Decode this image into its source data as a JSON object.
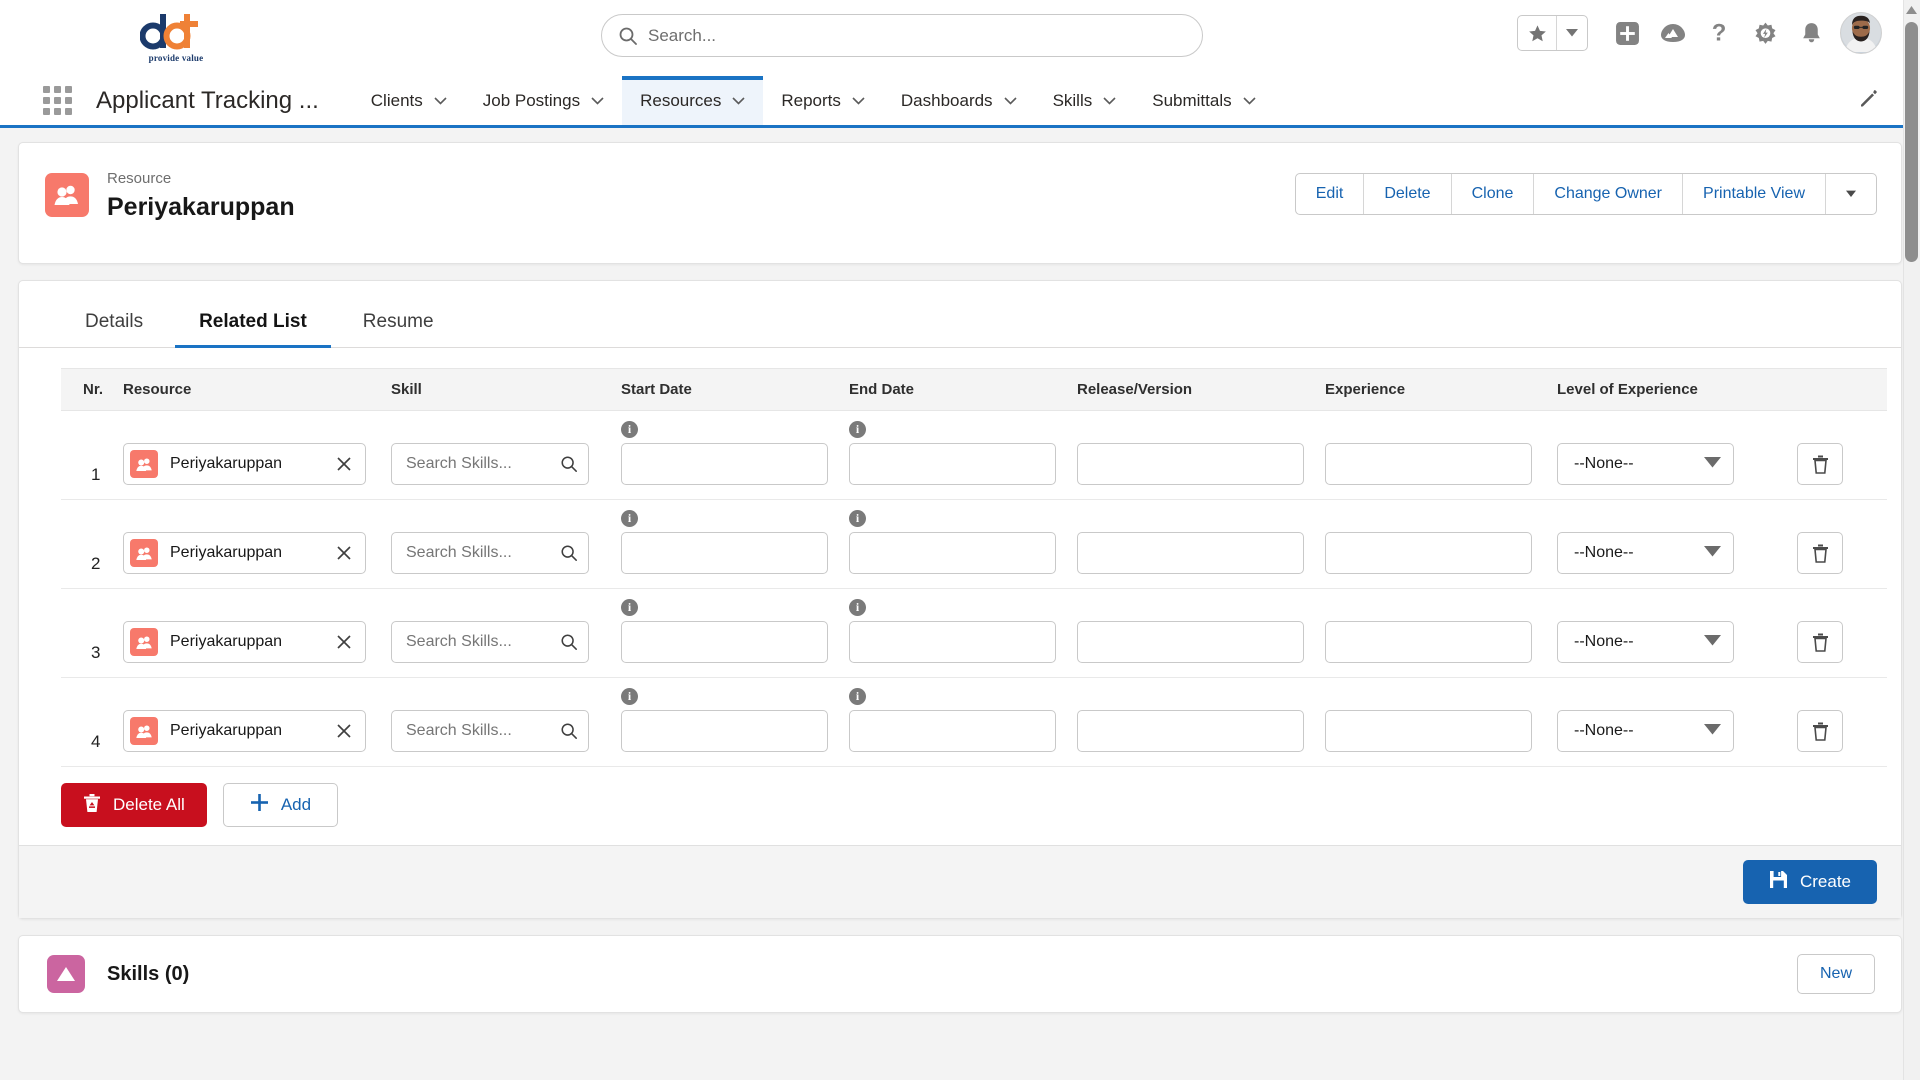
{
  "header": {
    "logo": {
      "mark": "dbt-logo",
      "tagline": "provide value"
    },
    "search": {
      "placeholder": "Search...",
      "icon": "search-icon"
    },
    "icons": [
      {
        "name": "favorites-star-icon",
        "glyph": "star"
      },
      {
        "name": "favorites-dropdown-icon",
        "glyph": "caret-down"
      },
      {
        "name": "global-add-icon",
        "glyph": "plus-square"
      },
      {
        "name": "trailhead-icon",
        "glyph": "mountain"
      },
      {
        "name": "help-icon",
        "glyph": "question"
      },
      {
        "name": "setup-gear-icon",
        "glyph": "gear"
      },
      {
        "name": "notifications-bell-icon",
        "glyph": "bell"
      },
      {
        "name": "user-avatar",
        "glyph": "avatar"
      }
    ]
  },
  "nav": {
    "app_launcher_icon": "app-launcher-waffle-icon",
    "app_name": "Applicant Tracking ...",
    "edit_nav_icon": "pencil-icon",
    "items": [
      {
        "label": "Clients",
        "active": false
      },
      {
        "label": "Job Postings",
        "active": false
      },
      {
        "label": "Resources",
        "active": true
      },
      {
        "label": "Reports",
        "active": false
      },
      {
        "label": "Dashboards",
        "active": false
      },
      {
        "label": "Skills",
        "active": false
      },
      {
        "label": "Submittals",
        "active": false
      }
    ]
  },
  "record": {
    "type_label": "Resource",
    "title": "Periyakaruppan",
    "icon": "resource-people-icon",
    "icon_color": "#f7796b",
    "actions": [
      "Edit",
      "Delete",
      "Clone",
      "Change Owner",
      "Printable View"
    ],
    "actions_more_icon": "caret-down-icon"
  },
  "tabs": [
    {
      "label": "Details",
      "active": false
    },
    {
      "label": "Related List",
      "active": true
    },
    {
      "label": "Resume",
      "active": false
    }
  ],
  "table": {
    "columns": [
      "Nr.",
      "Resource",
      "Skill",
      "Start Date",
      "End Date",
      "Release/Version",
      "Experience",
      "Level of Experience"
    ],
    "skill_placeholder": "Search Skills...",
    "none_option": "--None--",
    "rows": [
      {
        "nr": "1",
        "resource": "Periyakaruppan",
        "skill": "",
        "start_date": "",
        "end_date": "",
        "release_version": "",
        "experience": "",
        "level_of_experience": "--None--"
      },
      {
        "nr": "2",
        "resource": "Periyakaruppan",
        "skill": "",
        "start_date": "",
        "end_date": "",
        "release_version": "",
        "experience": "",
        "level_of_experience": "--None--"
      },
      {
        "nr": "3",
        "resource": "Periyakaruppan",
        "skill": "",
        "start_date": "",
        "end_date": "",
        "release_version": "",
        "experience": "",
        "level_of_experience": "--None--"
      },
      {
        "nr": "4",
        "resource": "Periyakaruppan",
        "skill": "",
        "start_date": "",
        "end_date": "",
        "release_version": "",
        "experience": "",
        "level_of_experience": "--None--"
      }
    ]
  },
  "bottom_actions": {
    "delete_all_label": "Delete All",
    "delete_all_icon": "recycle-bin-icon",
    "delete_all_color": "#c80f1e",
    "add_label": "Add",
    "add_icon": "plus-icon",
    "create_label": "Create",
    "create_icon": "save-floppy-icon",
    "create_color": "#1763b0"
  },
  "skills_section": {
    "title": "Skills (0)",
    "icon": "skills-triangle-icon",
    "icon_color": "#cb65a0",
    "new_label": "New"
  }
}
